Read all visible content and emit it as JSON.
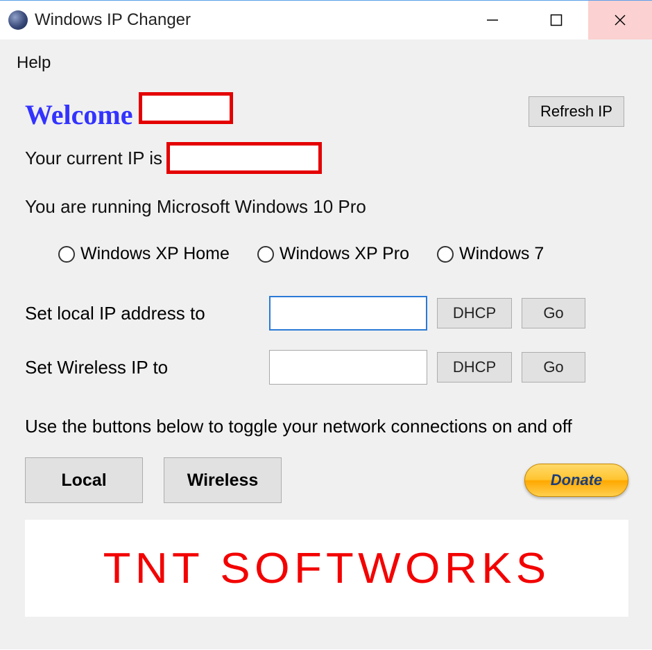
{
  "titlebar": {
    "title": "Windows IP Changer"
  },
  "menu": {
    "help": "Help"
  },
  "welcome": {
    "label": "Welcome",
    "ip_prefix": "Your current IP is",
    "os_line": "You are running Microsoft Windows 10 Pro"
  },
  "buttons": {
    "refresh": "Refresh IP",
    "dhcp": "DHCP",
    "go": "Go",
    "local": "Local",
    "wireless": "Wireless",
    "donate": "Donate"
  },
  "radios": {
    "xp_home": "Windows XP Home",
    "xp_pro": "Windows XP Pro",
    "win7": "Windows 7"
  },
  "set_local": {
    "label": "Set local IP address to",
    "value": ""
  },
  "set_wireless": {
    "label": "Set Wireless IP to",
    "value": ""
  },
  "instructions": "Use the buttons below to toggle your network connections on and off",
  "brand": "TNT SOFTWORKS"
}
